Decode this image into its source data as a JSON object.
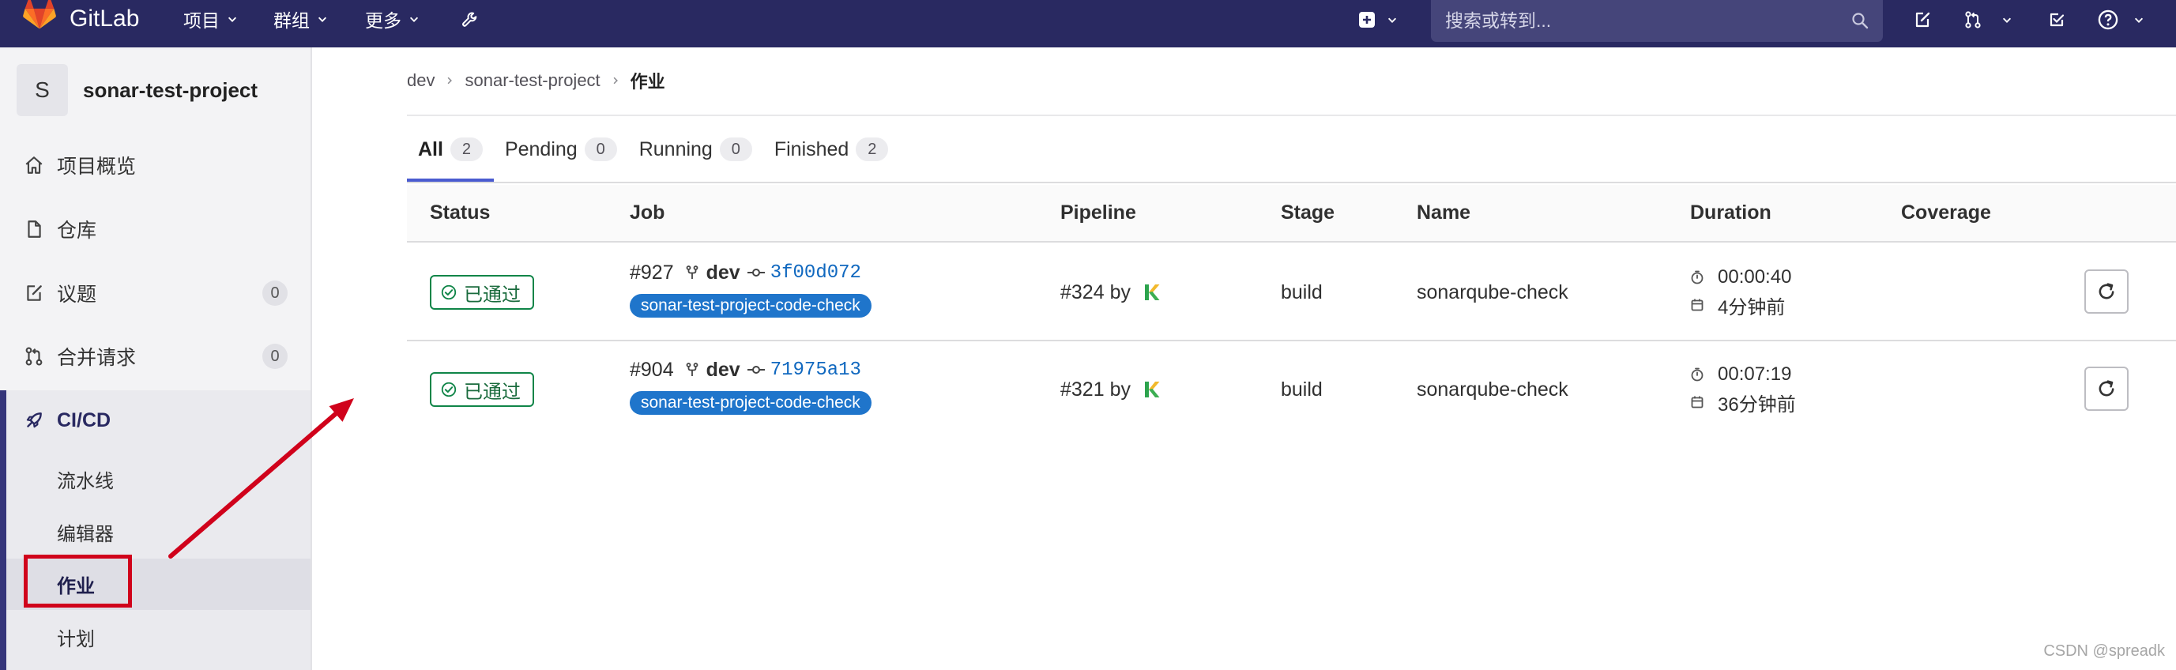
{
  "topbar": {
    "brand": "GitLab",
    "menu_projects": "项目",
    "menu_groups": "群组",
    "menu_more": "更多",
    "search_placeholder": "搜索或转到..."
  },
  "sidebar": {
    "avatar_letter": "S",
    "project_name": "sonar-test-project",
    "items": [
      {
        "label": "项目概览",
        "icon": "home-icon"
      },
      {
        "label": "仓库",
        "icon": "document-icon"
      },
      {
        "label": "议题",
        "icon": "issues-icon",
        "count": "0"
      },
      {
        "label": "合并请求",
        "icon": "merge-request-icon",
        "count": "0"
      }
    ],
    "cicd": {
      "label": "CI/CD",
      "icon": "rocket-icon",
      "active": true,
      "subitems": [
        {
          "label": "流水线",
          "active": false
        },
        {
          "label": "编辑器",
          "active": false
        },
        {
          "label": "作业",
          "active": true
        },
        {
          "label": "计划",
          "active": false
        }
      ]
    }
  },
  "breadcrumb": [
    "dev",
    "sonar-test-project",
    "作业"
  ],
  "tabs": [
    {
      "label": "All",
      "count": "2",
      "active": true
    },
    {
      "label": "Pending",
      "count": "0",
      "active": false
    },
    {
      "label": "Running",
      "count": "0",
      "active": false
    },
    {
      "label": "Finished",
      "count": "2",
      "active": false
    }
  ],
  "table": {
    "headers": {
      "status": "Status",
      "job": "Job",
      "pipeline": "Pipeline",
      "stage": "Stage",
      "name": "Name",
      "duration": "Duration",
      "coverage": "Coverage"
    },
    "rows": [
      {
        "status": "已通过",
        "job_id": "#927",
        "branch": "dev",
        "commit_sha": "3f00d072",
        "job_tag": "sonar-test-project-code-check",
        "pipeline_id": "#324",
        "pipeline_by": "by",
        "stage": "build",
        "name": "sonarqube-check",
        "duration": "00:00:40",
        "finished_ago": "4分钟前"
      },
      {
        "status": "已通过",
        "job_id": "#904",
        "branch": "dev",
        "commit_sha": "71975a13",
        "job_tag": "sonar-test-project-code-check",
        "pipeline_id": "#321",
        "pipeline_by": "by",
        "stage": "build",
        "name": "sonarqube-check",
        "duration": "00:07:19",
        "finished_ago": "36分钟前"
      }
    ]
  },
  "watermark": "CSDN @spreadk",
  "colors": {
    "topbar_bg": "#292961",
    "status_success": "#108548",
    "job_tag_bg": "#1f75cb",
    "link": "#1068bf",
    "tab_active": "#4a5bd0",
    "annotation_red": "#d0021b"
  }
}
